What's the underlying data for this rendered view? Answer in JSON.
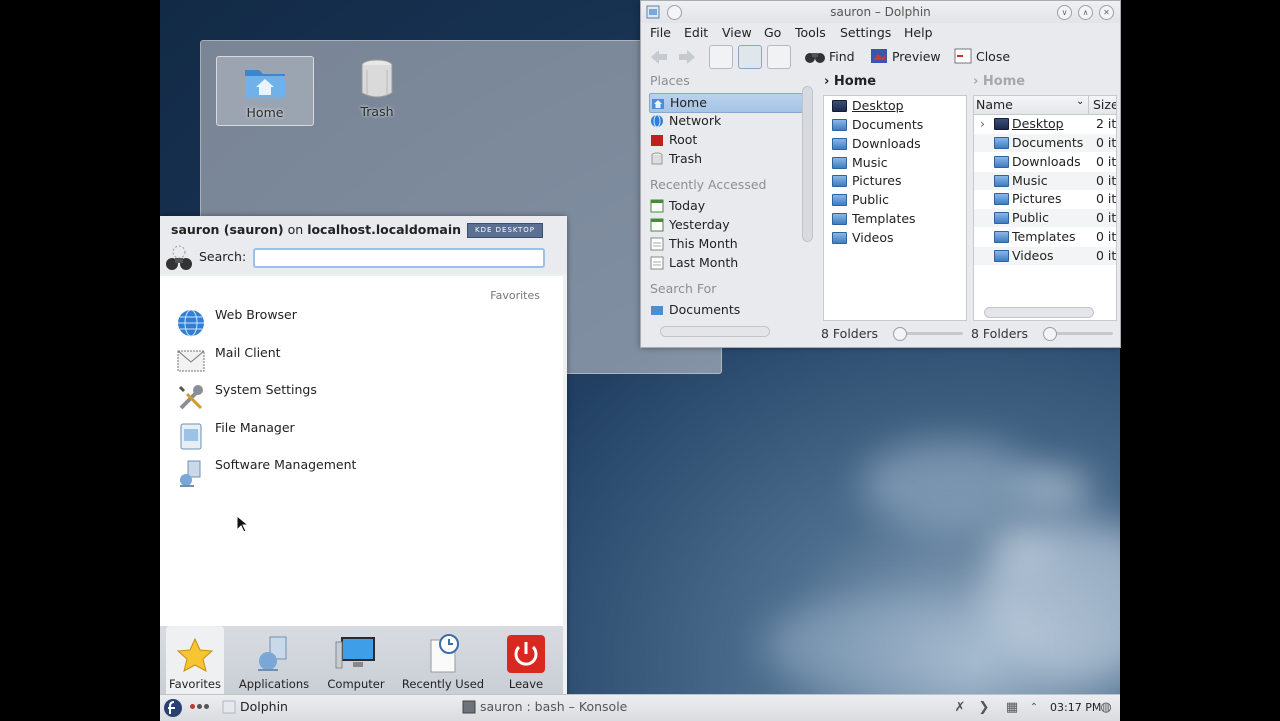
{
  "desktop": {
    "icons": [
      {
        "label": "Home",
        "icon": "home-folder-icon"
      },
      {
        "label": "Trash",
        "icon": "trash-icon"
      }
    ]
  },
  "kickoff": {
    "user_name": "sauron (sauron)",
    "on_word": "on",
    "host": "localhost.localdomain",
    "kde_badge": "KDE DESKTOP",
    "search_label": "Search:",
    "search_value": "",
    "section_label": "Favorites",
    "favorites": [
      {
        "label": "Web Browser",
        "icon": "globe-icon"
      },
      {
        "label": "Mail Client",
        "icon": "mail-client-icon"
      },
      {
        "label": "System Settings",
        "icon": "wrench-screwdriver-icon"
      },
      {
        "label": "File Manager",
        "icon": "file-manager-icon"
      },
      {
        "label": "Software Management",
        "icon": "software-management-icon"
      }
    ],
    "tabs": [
      {
        "label": "Favorites",
        "icon": "star-icon"
      },
      {
        "label": "Applications",
        "icon": "applications-icon"
      },
      {
        "label": "Computer",
        "icon": "computer-monitor-icon"
      },
      {
        "label": "Recently Used",
        "icon": "clock-document-icon"
      },
      {
        "label": "Leave",
        "icon": "power-icon"
      }
    ]
  },
  "dolphin": {
    "title": "sauron – Dolphin",
    "menu": [
      "File",
      "Edit",
      "View",
      "Go",
      "Tools",
      "Settings",
      "Help"
    ],
    "toolbar": {
      "find": "Find",
      "preview": "Preview",
      "close": "Close"
    },
    "places_header": "Places",
    "places": [
      "Home",
      "Network",
      "Root",
      "Trash"
    ],
    "recent_header": "Recently Accessed",
    "recent": [
      "Today",
      "Yesterday",
      "This Month",
      "Last Month"
    ],
    "search_header": "Search For",
    "search": [
      "Documents"
    ],
    "left_breadcrumb": "Home",
    "right_breadcrumb": "Home",
    "folders": [
      "Desktop",
      "Documents",
      "Downloads",
      "Music",
      "Pictures",
      "Public",
      "Templates",
      "Videos"
    ],
    "col_name": "Name",
    "col_size": "Size",
    "sizes": [
      "2 it",
      "0 it",
      "0 it",
      "0 it",
      "0 it",
      "0 it",
      "0 it",
      "0 it"
    ],
    "left_status": "8 Folders",
    "right_status": "8 Folders"
  },
  "taskbar": {
    "task1": "Dolphin",
    "task2": "sauron : bash – Konsole",
    "time": "03:17 PM"
  }
}
